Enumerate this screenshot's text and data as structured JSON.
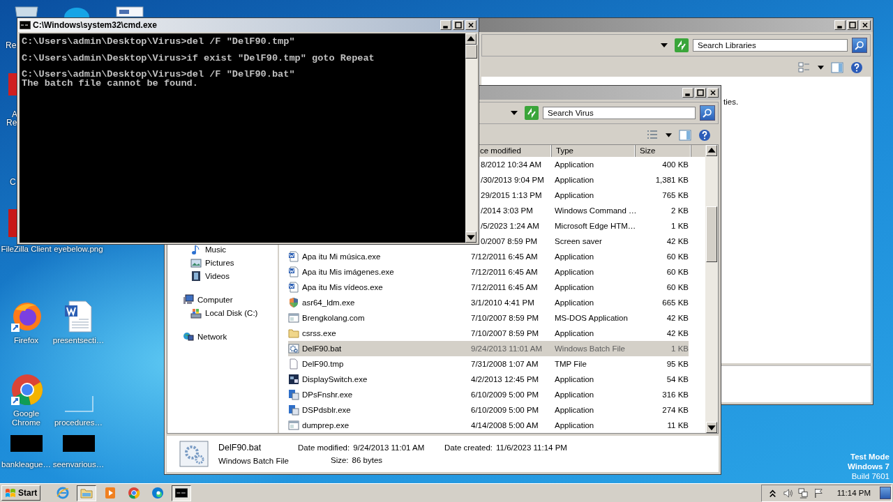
{
  "desktop": {
    "partial_labels": [
      "Re",
      "A",
      "Re",
      "C"
    ],
    "icons": [
      {
        "label": "FileZilla Client",
        "kind": "hidden"
      },
      {
        "label": "eyebelow.png",
        "kind": "hidden"
      },
      {
        "label": "Firefox",
        "kind": "firefox"
      },
      {
        "label": "presentsecti…",
        "kind": "word"
      },
      {
        "label": "Google Chrome",
        "kind": "chrome"
      },
      {
        "label": "procedures…",
        "kind": "blank"
      },
      {
        "label": "bankleague…",
        "kind": "thumb"
      },
      {
        "label": "seenvarious…",
        "kind": "thumb"
      }
    ],
    "os_notice": [
      "Test Mode",
      "Windows 7",
      "Build 7601"
    ]
  },
  "libraries_window": {
    "search": {
      "placeholder": "Search Libraries"
    },
    "content_text": "ties."
  },
  "explorer_window": {
    "search": {
      "placeholder": "Search Virus"
    },
    "nav": [
      {
        "children": [
          {
            "label": "Music",
            "kind": "music"
          },
          {
            "label": "Pictures",
            "kind": "pictures"
          },
          {
            "label": "Videos",
            "kind": "videos"
          }
        ]
      },
      {
        "label": "Computer",
        "kind": "computer",
        "children": [
          {
            "label": "Local Disk (C:)",
            "kind": "disk"
          }
        ]
      },
      {
        "label": "Network",
        "kind": "network"
      }
    ],
    "columns": [
      "ce modified",
      "Type",
      "Size"
    ],
    "rows": [
      {
        "date": "8/2012 10:34 AM",
        "type": "Application",
        "size": "400 KB",
        "selected": false
      },
      {
        "date": "/30/2013 9:04 PM",
        "type": "Application",
        "size": "1,381 KB",
        "selected": false
      },
      {
        "date": "29/2015 1:13 PM",
        "type": "Application",
        "size": "765 KB",
        "selected": false
      },
      {
        "date": "/2014 3:03 PM",
        "type": "Windows Command …",
        "size": "2 KB",
        "selected": false
      },
      {
        "date": "/5/2023 1:24 AM",
        "type": "Microsoft Edge HTM…",
        "size": "1 KB",
        "selected": false
      },
      {
        "date": "0/2007 8:59 PM",
        "type": "Screen saver",
        "size": "42 KB",
        "selected": false
      },
      {
        "name": "Apa itu Mi música.exe",
        "kind": "word",
        "date": "7/12/2011 6:45 AM",
        "type": "Application",
        "size": "60 KB",
        "selected": false
      },
      {
        "name": "Apa itu Mis imágenes.exe",
        "kind": "word",
        "date": "7/12/2011 6:45 AM",
        "type": "Application",
        "size": "60 KB",
        "selected": false
      },
      {
        "name": "Apa itu Mis vídeos.exe",
        "kind": "word",
        "date": "7/12/2011 6:45 AM",
        "type": "Application",
        "size": "60 KB",
        "selected": false
      },
      {
        "name": "asr64_ldm.exe",
        "kind": "shield",
        "date": "3/1/2010 4:41 PM",
        "type": "Application",
        "size": "665 KB",
        "selected": false
      },
      {
        "name": "Brengkolang.com",
        "kind": "dos",
        "date": "7/10/2007 8:59 PM",
        "type": "MS-DOS Application",
        "size": "42 KB",
        "selected": false
      },
      {
        "name": "csrss.exe",
        "kind": "folder",
        "date": "7/10/2007 8:59 PM",
        "type": "Application",
        "size": "42 KB",
        "selected": false
      },
      {
        "name": "DelF90.bat",
        "kind": "bat",
        "date": "9/24/2013 11:01 AM",
        "type": "Windows Batch File",
        "size": "1 KB",
        "selected": true
      },
      {
        "name": "DelF90.tmp",
        "kind": "blank",
        "date": "7/31/2008 1:07 AM",
        "type": "TMP File",
        "size": "95 KB",
        "selected": false
      },
      {
        "name": "DisplaySwitch.exe",
        "kind": "display",
        "date": "4/2/2013 12:45 PM",
        "type": "Application",
        "size": "54 KB",
        "selected": false
      },
      {
        "name": "DPsFnshr.exe",
        "kind": "app",
        "date": "6/10/2009 5:00 PM",
        "type": "Application",
        "size": "316 KB",
        "selected": false
      },
      {
        "name": "DSPdsblr.exe",
        "kind": "app",
        "date": "6/10/2009 5:00 PM",
        "type": "Application",
        "size": "274 KB",
        "selected": false
      },
      {
        "name": "dumprep.exe",
        "kind": "dos",
        "date": "4/14/2008 5:00 AM",
        "type": "Application",
        "size": "11 KB",
        "selected": false
      }
    ],
    "details": {
      "name": "DelF90.bat",
      "type": "Windows Batch File",
      "fields": [
        {
          "label": "Date modified:",
          "value": "9/24/2013 11:01 AM"
        },
        {
          "label": "Date created:",
          "value": "11/6/2023 11:14 PM"
        },
        {
          "label": "Size:",
          "value": "86 bytes"
        }
      ]
    }
  },
  "cmd_window": {
    "title": "C:\\Windows\\system32\\cmd.exe",
    "blocks": [
      [
        "C:\\Users\\admin\\Desktop\\Virus>del /F \"DelF90.tmp\""
      ],
      [
        "C:\\Users\\admin\\Desktop\\Virus>if exist \"DelF90.tmp\" goto Repeat"
      ],
      [
        "C:\\Users\\admin\\Desktop\\Virus>del /F \"DelF90.bat\"",
        "The batch file cannot be found."
      ]
    ]
  },
  "taskbar": {
    "start": "Start",
    "apps": [
      {
        "kind": "ie",
        "selected": false
      },
      {
        "kind": "explorer",
        "selected": true
      },
      {
        "kind": "media",
        "selected": false
      },
      {
        "kind": "chrome",
        "selected": false
      },
      {
        "kind": "edge",
        "selected": false
      },
      {
        "kind": "cmd",
        "selected": true
      }
    ],
    "clock": "11:14 PM"
  }
}
